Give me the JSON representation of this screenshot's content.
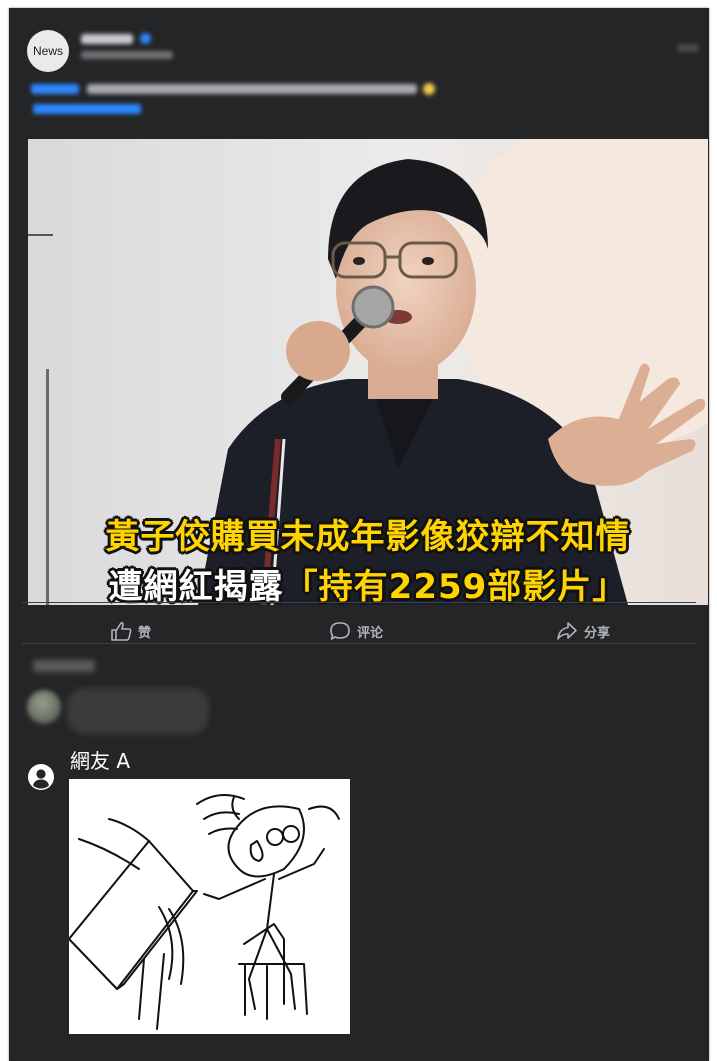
{
  "post": {
    "page_avatar_text": "News",
    "image_caption": {
      "line1": "黃子佼購買未成年影像狡辯不知情",
      "line2_white": "遭網紅揭露",
      "line2_yellow": "「持有2259部影片」"
    },
    "actions": [
      {
        "label": "赞",
        "icon": "thumbs-up-icon"
      },
      {
        "label": "评论",
        "icon": "comment-icon"
      },
      {
        "label": "分享",
        "icon": "share-icon"
      }
    ]
  },
  "comment": {
    "author": "網友 A",
    "avatar_icon": "user-silhouette-icon",
    "attachment_icon": "table-flip-meme"
  },
  "colors": {
    "card_background": "#242526",
    "caption_yellow": "#ffd400",
    "action_text": "#b0b3b8",
    "link_blue": "#2d88ff"
  }
}
